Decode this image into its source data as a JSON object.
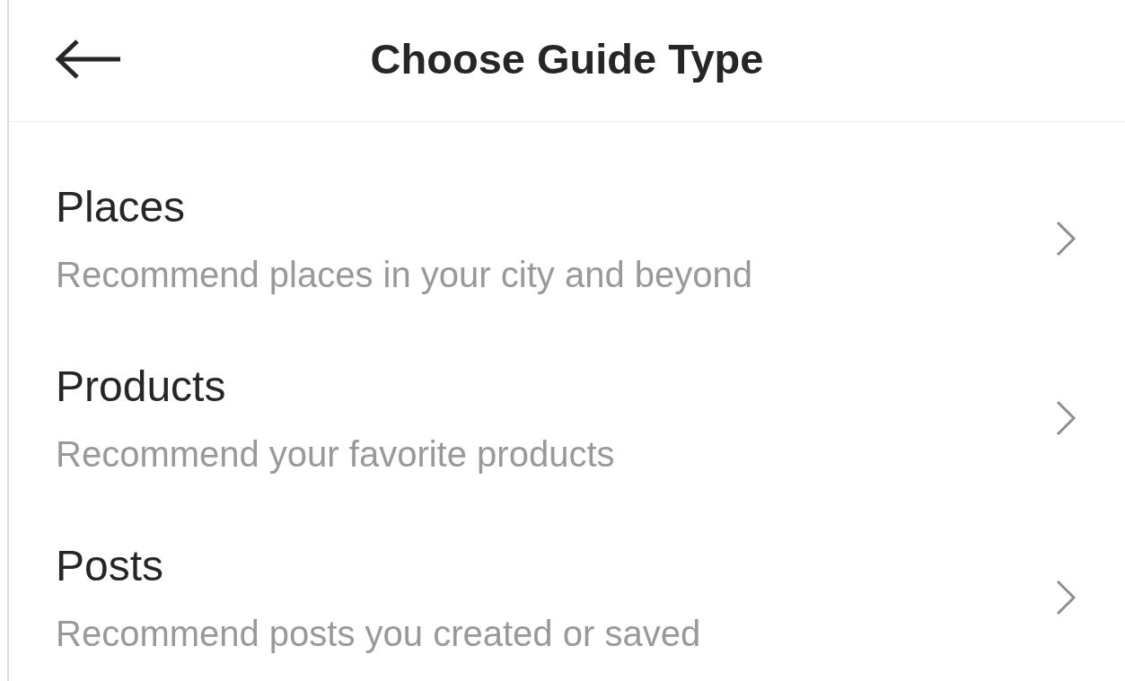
{
  "header": {
    "title": "Choose Guide Type"
  },
  "guide_types": [
    {
      "title": "Places",
      "description": "Recommend places in your city and beyond"
    },
    {
      "title": "Products",
      "description": "Recommend your favorite products"
    },
    {
      "title": "Posts",
      "description": "Recommend posts you created or saved"
    }
  ]
}
